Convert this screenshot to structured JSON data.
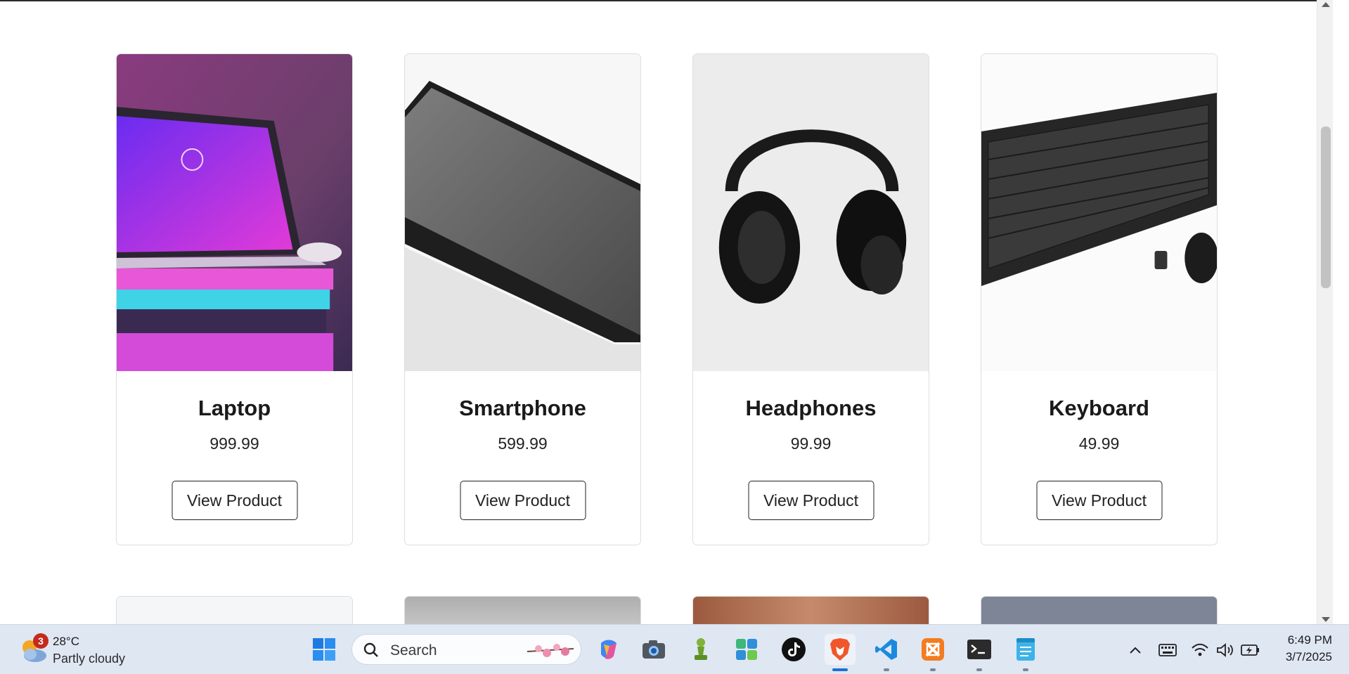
{
  "products": [
    {
      "name": "Laptop",
      "price": "999.99",
      "button": "View Product",
      "image": "laptop-photo"
    },
    {
      "name": "Smartphone",
      "price": "599.99",
      "button": "View Product",
      "image": "smartphone-photo"
    },
    {
      "name": "Headphones",
      "price": "99.99",
      "button": "View Product",
      "image": "headphones-photo"
    },
    {
      "name": "Keyboard",
      "price": "49.99",
      "button": "View Product",
      "image": "keyboard-photo"
    }
  ],
  "taskbar": {
    "weather": {
      "temp": "28°C",
      "condition": "Partly cloudy",
      "badge": "3"
    },
    "search_label": "Search",
    "apps": [
      "windows-start-icon",
      "copilot-icon",
      "camera-icon",
      "chess-icon",
      "widgets-app-icon",
      "tiktok-icon",
      "brave-browser-icon",
      "vscode-icon",
      "xampp-icon",
      "terminal-icon",
      "notepad-icon"
    ],
    "clock": {
      "time": "6:49 PM",
      "date": "3/7/2025"
    }
  },
  "colors": {
    "accent": "#1f6fd1",
    "taskbar": "#dfe7f3",
    "card_border": "#dedede"
  }
}
